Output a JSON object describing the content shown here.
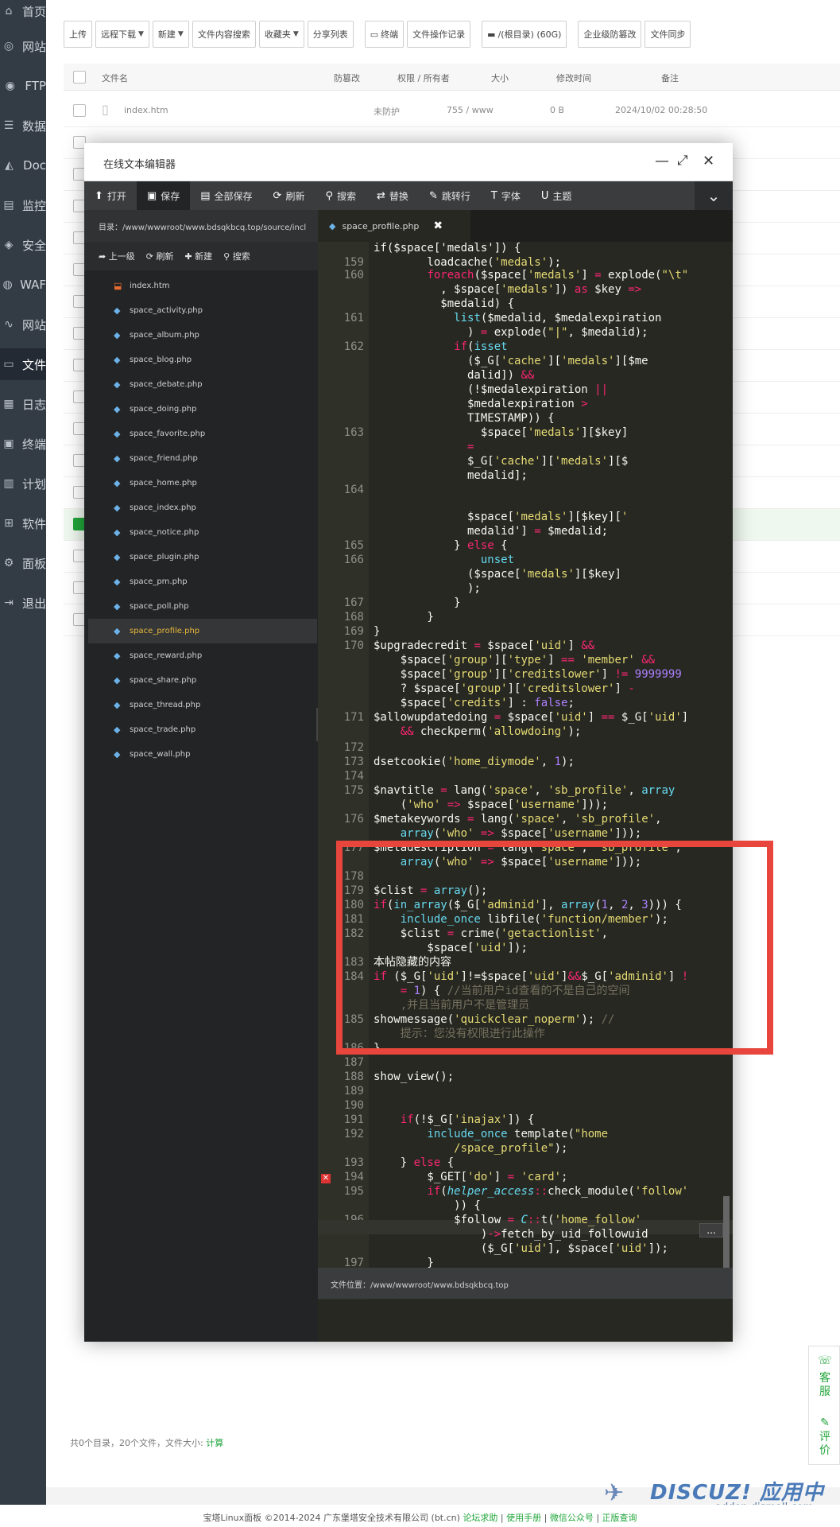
{
  "nav": {
    "items": [
      {
        "label": "首页",
        "icon": "home-icon",
        "glyph": "⌂"
      },
      {
        "label": "网站",
        "icon": "globe-icon",
        "glyph": "◎"
      },
      {
        "label": "FTP",
        "icon": "ftp-icon",
        "glyph": "◉"
      },
      {
        "label": "数据",
        "icon": "database-icon",
        "glyph": "☰"
      },
      {
        "label": "Doc",
        "icon": "docker-icon",
        "glyph": "◭"
      },
      {
        "label": "监控",
        "icon": "monitor-icon",
        "glyph": "▤"
      },
      {
        "label": "安全",
        "icon": "shield-icon",
        "glyph": "◈"
      },
      {
        "label": "WAF",
        "icon": "waf-icon",
        "glyph": "◍"
      },
      {
        "label": "网站",
        "icon": "chart-icon",
        "glyph": "∿"
      },
      {
        "label": "文件",
        "icon": "folder-icon",
        "glyph": "▭"
      },
      {
        "label": "日志",
        "icon": "log-icon",
        "glyph": "▦"
      },
      {
        "label": "终端",
        "icon": "terminal-icon",
        "glyph": "▣"
      },
      {
        "label": "计划",
        "icon": "calendar-icon",
        "glyph": "▥"
      },
      {
        "label": "软件",
        "icon": "apps-icon",
        "glyph": "⊞"
      },
      {
        "label": "面板",
        "icon": "gear-icon",
        "glyph": "⚙"
      },
      {
        "label": "退出",
        "icon": "logout-icon",
        "glyph": "⇥"
      }
    ]
  },
  "file_manager": {
    "toolbar": [
      "上传",
      "远程下载",
      "新建",
      "文件内容搜索",
      "收藏夹",
      "分享列表",
      "终端",
      "文件操作记录",
      "/(根目录) (60G)",
      "企业级防篡改",
      "文件同步"
    ],
    "columns": [
      "文件名",
      "防篡改",
      "权限 / 所有者",
      "大小",
      "修改时间",
      "备注"
    ],
    "rows": [
      {
        "name": "index.htm",
        "protect": "未防护",
        "perm": "755 / www",
        "size": "0 B",
        "mtime": "2024/10/02 00:28:50"
      },
      {
        "name": "",
        "protect": "",
        "perm": "",
        "size": "",
        "mtime": ""
      }
    ],
    "footer_text": "共0个目录，20个文件，文件大小:",
    "footer_link": "计算"
  },
  "editor": {
    "title": "在线文本编辑器",
    "menu": [
      {
        "label": "打开",
        "icon": "upload-icon",
        "glyph": "⬆"
      },
      {
        "label": "保存",
        "icon": "save-icon",
        "glyph": "▣"
      },
      {
        "label": "全部保存",
        "icon": "save-all-icon",
        "glyph": "▤"
      },
      {
        "label": "刷新",
        "icon": "refresh-icon",
        "glyph": "⟳"
      },
      {
        "label": "搜索",
        "icon": "search-icon",
        "glyph": "⚲"
      },
      {
        "label": "替换",
        "icon": "replace-icon",
        "glyph": "⇄"
      },
      {
        "label": "跳转行",
        "icon": "goto-icon",
        "glyph": "✎"
      },
      {
        "label": "字体",
        "icon": "font-icon",
        "glyph": "T"
      },
      {
        "label": "主题",
        "icon": "theme-icon",
        "glyph": "U"
      }
    ],
    "path_label": "目录：",
    "path": "/www/wwwroot/www.bdsqkbcq.top/source/incl",
    "side_tools": [
      "上一级",
      "刷新",
      "新建",
      "搜索"
    ],
    "files": [
      "index.htm",
      "space_activity.php",
      "space_album.php",
      "space_blog.php",
      "space_debate.php",
      "space_doing.php",
      "space_favorite.php",
      "space_friend.php",
      "space_home.php",
      "space_index.php",
      "space_notice.php",
      "space_plugin.php",
      "space_pm.php",
      "space_poll.php",
      "space_profile.php",
      "space_reward.php",
      "space_share.php",
      "space_thread.php",
      "space_trade.php",
      "space_wall.php"
    ],
    "selected_file": "space_profile.php",
    "tab": "space_profile.php",
    "status": "文件位置：/www/wwwroot/www.bdsqkbcq.top",
    "dots": "..."
  },
  "footer": {
    "copyright": "宝塔Linux面板 ©2014-2024 广东堡塔安全技术有限公司 (bt.cn)",
    "links": [
      "论坛求助",
      "使用手册",
      "微信公众号",
      "正版查询"
    ]
  },
  "float_panel": {
    "items": [
      "客服",
      "评价"
    ]
  },
  "watermark": {
    "logo": "DISCUZ! 应用中心",
    "url": "addon.dismall.com"
  },
  "colors": {
    "accent": "#20a53a",
    "highlight_box": "#e8453c",
    "editor_bg": "#272822"
  }
}
